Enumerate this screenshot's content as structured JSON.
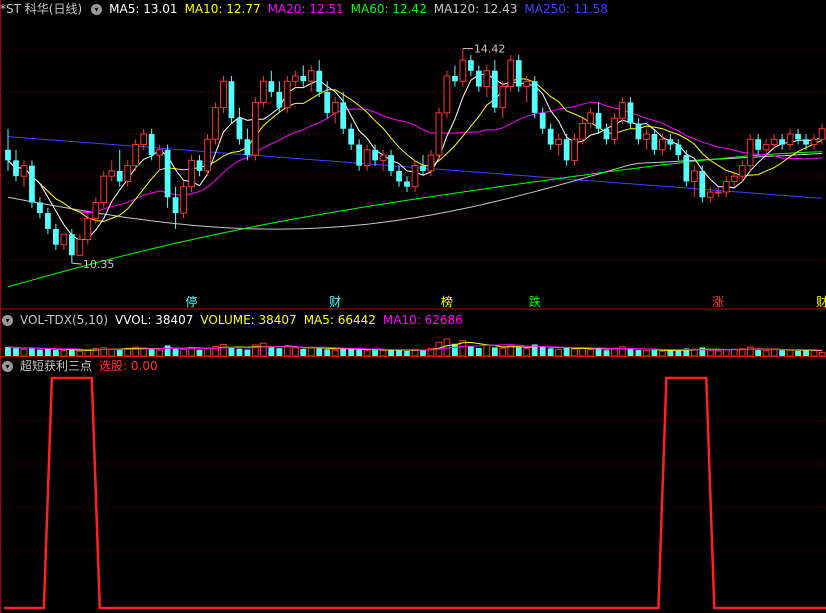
{
  "main_legend": {
    "title": "*ST 科华(日线)",
    "items": [
      {
        "label": "MA5: 13.01",
        "color": "#ffffff"
      },
      {
        "label": "MA10: 12.77",
        "color": "#ffff00"
      },
      {
        "label": "MA20: 12.51",
        "color": "#ff00ff"
      },
      {
        "label": "MA60: 12.42",
        "color": "#00ff00"
      },
      {
        "label": "MA120: 12.43",
        "color": "#c8c8c8"
      },
      {
        "label": "MA250: 11.58",
        "color": "#4040ff"
      }
    ]
  },
  "vol_legend": {
    "title": "VOL-TDX(5,10)",
    "items": [
      {
        "label": "VVOL: 38407",
        "color": "#ffffff"
      },
      {
        "label": "VOLUME: 38407",
        "color": "#ffff00"
      },
      {
        "label": "MA5: 66442",
        "color": "#ffff00"
      },
      {
        "label": "MA10: 62686",
        "color": "#ff00ff"
      }
    ]
  },
  "ind_legend": {
    "title": "超短获利三点",
    "items": [
      {
        "label": "选股: 0.00",
        "color": "#ff3030"
      }
    ]
  },
  "colors": {
    "up": "#ff3232",
    "down": "#54ffff",
    "grid": "#7a0000",
    "signal": "#ff2020"
  },
  "chart_data": [
    {
      "type": "candlestick",
      "title": "*ST 科华(日线)",
      "ylim": [
        9.5,
        15.0
      ],
      "annotations": [
        {
          "text": "14.42",
          "value": 14.42,
          "index": 57
        },
        {
          "text": "10.35",
          "value": 10.35,
          "index": 8
        }
      ],
      "markers": [
        {
          "text": "停",
          "index": 23,
          "color": "#54ffff"
        },
        {
          "text": "财",
          "index": 41,
          "color": "#54ffff"
        },
        {
          "text": "榜",
          "index": 55,
          "color": "#ffff00"
        },
        {
          "text": "跌",
          "index": 66,
          "color": "#00ff00"
        },
        {
          "text": "涨",
          "index": 89,
          "color": "#ff3232"
        },
        {
          "text": "财",
          "index": 102,
          "color": "#ffff00"
        }
      ],
      "ohlc": [
        [
          12.5,
          12.9,
          12.1,
          12.3
        ],
        [
          12.3,
          12.5,
          11.9,
          12.0
        ],
        [
          12.0,
          12.3,
          11.8,
          12.2
        ],
        [
          12.2,
          12.3,
          11.4,
          11.5
        ],
        [
          11.5,
          11.6,
          11.2,
          11.3
        ],
        [
          11.3,
          11.4,
          10.9,
          11.0
        ],
        [
          11.0,
          11.1,
          10.6,
          10.7
        ],
        [
          10.7,
          10.9,
          10.6,
          10.9
        ],
        [
          10.9,
          11.0,
          10.35,
          10.5
        ],
        [
          10.5,
          10.9,
          10.5,
          10.8
        ],
        [
          10.8,
          11.3,
          10.7,
          11.2
        ],
        [
          11.2,
          11.6,
          11.1,
          11.5
        ],
        [
          11.5,
          12.1,
          11.4,
          12.0
        ],
        [
          12.0,
          12.3,
          11.9,
          12.1
        ],
        [
          12.1,
          12.5,
          11.8,
          11.9
        ],
        [
          11.9,
          12.3,
          11.8,
          12.2
        ],
        [
          12.2,
          12.7,
          12.1,
          12.6
        ],
        [
          12.6,
          12.9,
          12.5,
          12.8
        ],
        [
          12.8,
          12.9,
          12.3,
          12.4
        ],
        [
          12.4,
          12.6,
          12.1,
          12.5
        ],
        [
          12.5,
          12.6,
          11.4,
          11.6
        ],
        [
          11.6,
          11.8,
          11.0,
          11.3
        ],
        [
          11.3,
          11.9,
          11.2,
          11.8
        ],
        [
          11.8,
          12.4,
          11.7,
          12.3
        ],
        [
          12.3,
          12.4,
          12.0,
          12.1
        ],
        [
          12.1,
          12.8,
          12.0,
          12.7
        ],
        [
          12.7,
          13.4,
          12.6,
          13.3
        ],
        [
          13.3,
          13.9,
          13.2,
          13.8
        ],
        [
          13.8,
          13.9,
          13.0,
          13.1
        ],
        [
          13.1,
          13.3,
          12.6,
          12.7
        ],
        [
          12.7,
          12.9,
          12.3,
          12.4
        ],
        [
          12.4,
          13.5,
          12.3,
          13.4
        ],
        [
          13.4,
          13.9,
          13.3,
          13.8
        ],
        [
          13.8,
          14.0,
          13.5,
          13.6
        ],
        [
          13.6,
          13.8,
          13.2,
          13.3
        ],
        [
          13.3,
          13.9,
          13.2,
          13.8
        ],
        [
          13.8,
          14.0,
          13.7,
          13.9
        ],
        [
          13.9,
          14.1,
          13.7,
          13.8
        ],
        [
          13.8,
          14.1,
          13.6,
          14.0
        ],
        [
          14.0,
          14.2,
          13.5,
          13.6
        ],
        [
          13.6,
          13.8,
          13.1,
          13.2
        ],
        [
          13.2,
          13.5,
          13.0,
          13.4
        ],
        [
          13.4,
          13.6,
          12.8,
          12.9
        ],
        [
          12.9,
          13.0,
          12.5,
          12.6
        ],
        [
          12.6,
          12.7,
          12.1,
          12.2
        ],
        [
          12.2,
          12.6,
          12.1,
          12.5
        ],
        [
          12.5,
          12.6,
          12.2,
          12.3
        ],
        [
          12.3,
          12.5,
          12.1,
          12.4
        ],
        [
          12.4,
          12.5,
          12.0,
          12.1
        ],
        [
          12.1,
          12.2,
          11.8,
          11.9
        ],
        [
          11.9,
          12.0,
          11.7,
          11.8
        ],
        [
          11.8,
          12.3,
          11.7,
          12.2
        ],
        [
          12.2,
          12.4,
          12.0,
          12.1
        ],
        [
          12.1,
          12.5,
          12.0,
          12.4
        ],
        [
          12.4,
          13.3,
          12.3,
          13.2
        ],
        [
          13.2,
          14.0,
          13.1,
          13.9
        ],
        [
          13.9,
          14.1,
          13.7,
          13.8
        ],
        [
          13.8,
          14.42,
          13.7,
          14.2
        ],
        [
          14.2,
          14.3,
          13.9,
          14.0
        ],
        [
          14.0,
          14.1,
          13.6,
          13.7
        ],
        [
          13.7,
          14.1,
          13.5,
          14.0
        ],
        [
          14.0,
          14.2,
          13.2,
          13.3
        ],
        [
          13.3,
          13.8,
          13.1,
          13.7
        ],
        [
          13.7,
          14.3,
          13.6,
          14.2
        ],
        [
          14.2,
          14.3,
          13.6,
          13.7
        ],
        [
          13.7,
          13.9,
          13.4,
          13.8
        ],
        [
          13.8,
          13.9,
          13.1,
          13.2
        ],
        [
          13.2,
          13.3,
          12.8,
          12.9
        ],
        [
          12.9,
          13.0,
          12.5,
          12.6
        ],
        [
          12.6,
          12.8,
          12.4,
          12.7
        ],
        [
          12.7,
          12.8,
          12.2,
          12.3
        ],
        [
          12.3,
          12.8,
          12.2,
          12.7
        ],
        [
          12.7,
          13.1,
          12.6,
          13.0
        ],
        [
          13.0,
          13.3,
          12.9,
          13.2
        ],
        [
          13.2,
          13.4,
          12.8,
          12.9
        ],
        [
          12.9,
          13.0,
          12.6,
          12.7
        ],
        [
          12.7,
          13.2,
          12.6,
          13.1
        ],
        [
          13.1,
          13.5,
          13.0,
          13.4
        ],
        [
          13.4,
          13.5,
          12.9,
          13.0
        ],
        [
          13.0,
          13.1,
          12.6,
          12.7
        ],
        [
          12.7,
          12.9,
          12.5,
          12.8
        ],
        [
          12.8,
          12.9,
          12.4,
          12.5
        ],
        [
          12.5,
          12.8,
          12.4,
          12.7
        ],
        [
          12.7,
          12.8,
          12.5,
          12.6
        ],
        [
          12.6,
          12.7,
          12.3,
          12.4
        ],
        [
          12.4,
          12.5,
          11.8,
          11.9
        ],
        [
          11.9,
          12.2,
          11.6,
          12.1
        ],
        [
          12.1,
          12.2,
          11.5,
          11.6
        ],
        [
          11.6,
          11.8,
          11.5,
          11.7
        ],
        [
          11.7,
          11.8,
          11.6,
          11.7
        ],
        [
          11.7,
          12.0,
          11.6,
          11.9
        ],
        [
          11.9,
          12.1,
          11.8,
          12.0
        ],
        [
          12.0,
          12.3,
          11.9,
          12.2
        ],
        [
          12.2,
          12.8,
          12.1,
          12.7
        ],
        [
          12.7,
          12.8,
          12.4,
          12.5
        ],
        [
          12.5,
          12.7,
          12.4,
          12.6
        ],
        [
          12.6,
          12.8,
          12.5,
          12.7
        ],
        [
          12.7,
          12.8,
          12.5,
          12.6
        ],
        [
          12.6,
          12.9,
          12.5,
          12.8
        ],
        [
          12.8,
          12.9,
          12.6,
          12.7
        ],
        [
          12.7,
          12.8,
          12.5,
          12.6
        ],
        [
          12.6,
          12.8,
          12.5,
          12.7
        ],
        [
          12.7,
          13.0,
          12.6,
          12.9
        ]
      ],
      "ma_values": {
        "MA5": 13.01,
        "MA10": 12.77,
        "MA20": 12.51,
        "MA60": 12.42,
        "MA120": 12.43,
        "MA250": 11.58
      }
    },
    {
      "type": "bar",
      "title": "VOL-TDX(5,10)",
      "ylim": [
        0,
        300000
      ],
      "values": [
        98000,
        84000,
        72000,
        91000,
        69000,
        76000,
        64000,
        58000,
        71000,
        52000,
        61000,
        79000,
        88000,
        74000,
        67000,
        82000,
        95000,
        86000,
        72000,
        64000,
        113000,
        89000,
        71000,
        92000,
        68000,
        84000,
        101000,
        124000,
        96000,
        78000,
        69000,
        118000,
        137000,
        92000,
        84000,
        106000,
        88000,
        76000,
        94000,
        82000,
        71000,
        64000,
        86000,
        72000,
        66000,
        61000,
        74000,
        58000,
        62000,
        67000,
        54000,
        71000,
        63000,
        82000,
        148000,
        182000,
        131000,
        164000,
        102000,
        86000,
        118000,
        92000,
        84000,
        116000,
        93000,
        78000,
        124000,
        97000,
        82000,
        71000,
        88000,
        76000,
        91000,
        69000,
        78000,
        62000,
        84000,
        98000,
        72000,
        64000,
        58000,
        66000,
        52000,
        61000,
        57000,
        81000,
        74000,
        92000,
        61000,
        54000,
        68000,
        72000,
        78000,
        96000,
        64000,
        58000,
        71000,
        63000,
        67000,
        55000,
        62000,
        59000,
        38407
      ],
      "ma5": 66442,
      "ma10": 62686
    },
    {
      "type": "line",
      "title": "超短获利三点",
      "ylim": [
        0,
        1
      ],
      "x_count": 103,
      "signal_spans": [
        [
          6,
          11
        ],
        [
          83,
          88
        ]
      ],
      "current": 0.0
    }
  ]
}
